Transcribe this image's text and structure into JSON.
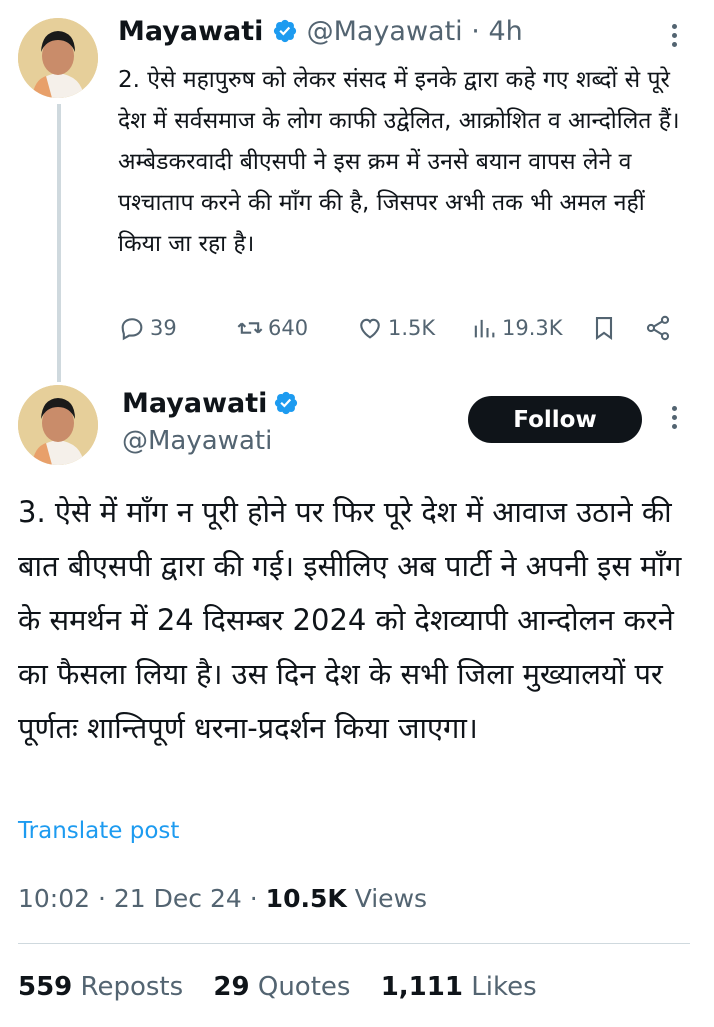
{
  "tweet1": {
    "name": "Mayawati",
    "handle": "@Mayawati",
    "time": "4h",
    "text": "2. ऐसे महापुरुष को लेकर संसद में इनके द्वारा कहे गए शब्दों से पूरे देश में सर्वसमाज के लोग काफी उद्वेलित, आक्रोशित व आन्दोलित हैं। अम्बेडकरवादी बीएसपी ने इस क्रम में उनसे बयान वापस लेने व पश्चाताप करने की माँग की है, जिसपर अभी तक भी अमल नहीं किया जा रहा है।",
    "actions": {
      "replies": "39",
      "reposts": "640",
      "likes": "1.5K",
      "views": "19.3K"
    }
  },
  "tweet2": {
    "name": "Mayawati",
    "handle": "@Mayawati",
    "follow_label": "Follow",
    "text": "3. ऐसे में माँग न पूरी होने पर फिर पूरे देश में आवाज उठाने की बात बीएसपी द्वारा की गई। इसीलिए अब पार्टी ने अपनी इस माँग के समर्थन में 24 दिसम्बर 2024 को देशव्यापी आन्दोलन करने का फैसला लिया है। उस दिन देश के सभी जिला मुख्यालयों पर पूर्णतः शान्तिपूर्ण धरना-प्रदर्शन किया जाएगा।",
    "translate_label": "Translate post",
    "time": "10:02",
    "date": "21 Dec 24",
    "views_count": "10.5K",
    "views_label": "Views",
    "separator": "·",
    "stats": {
      "reposts_count": "559",
      "reposts_label": "Reposts",
      "quotes_count": "29",
      "quotes_label": "Quotes",
      "likes_count": "1,111",
      "likes_label": "Likes"
    }
  },
  "colors": {
    "accent": "#1d9bf0",
    "text": "#0f1419",
    "muted": "#536471",
    "line": "#cfd9de"
  }
}
